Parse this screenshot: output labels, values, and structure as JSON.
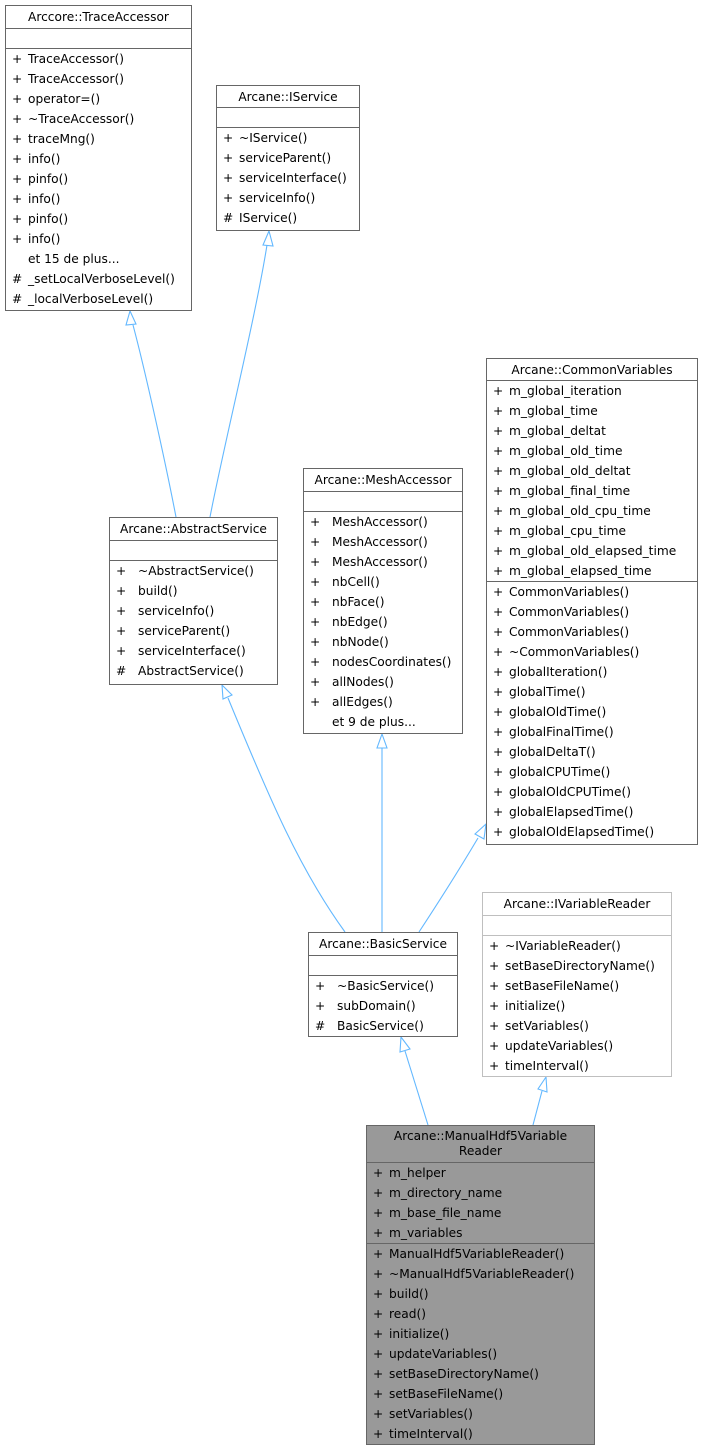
{
  "diagram": {
    "type": "class-inheritance",
    "edge_color": "#63b8ff",
    "focus_fill": "#999999",
    "classes": {
      "trace_accessor": {
        "name": "Arccore::TraceAccessor",
        "attributes": [],
        "methods": [
          {
            "vis": "+",
            "name": "TraceAccessor()"
          },
          {
            "vis": "+",
            "name": "TraceAccessor()"
          },
          {
            "vis": "+",
            "name": "operator=()"
          },
          {
            "vis": "+",
            "name": "~TraceAccessor()"
          },
          {
            "vis": "+",
            "name": "traceMng()"
          },
          {
            "vis": "+",
            "name": "info()"
          },
          {
            "vis": "+",
            "name": "pinfo()"
          },
          {
            "vis": "+",
            "name": "info()"
          },
          {
            "vis": "+",
            "name": "pinfo()"
          },
          {
            "vis": "+",
            "name": "info()"
          },
          {
            "vis": "",
            "name": "et 15 de plus..."
          },
          {
            "vis": "#",
            "name": "_setLocalVerboseLevel()"
          },
          {
            "vis": "#",
            "name": "_localVerboseLevel()"
          }
        ]
      },
      "iservice": {
        "name": "Arcane::IService",
        "attributes": [],
        "methods": [
          {
            "vis": "+",
            "name": "~IService()"
          },
          {
            "vis": "+",
            "name": "serviceParent()"
          },
          {
            "vis": "+",
            "name": "serviceInterface()"
          },
          {
            "vis": "+",
            "name": "serviceInfo()"
          },
          {
            "vis": "#",
            "name": "IService()"
          }
        ]
      },
      "common_variables": {
        "name": "Arcane::CommonVariables",
        "attributes": [
          {
            "vis": "+",
            "name": "m_global_iteration"
          },
          {
            "vis": "+",
            "name": "m_global_time"
          },
          {
            "vis": "+",
            "name": "m_global_deltat"
          },
          {
            "vis": "+",
            "name": "m_global_old_time"
          },
          {
            "vis": "+",
            "name": "m_global_old_deltat"
          },
          {
            "vis": "+",
            "name": "m_global_final_time"
          },
          {
            "vis": "+",
            "name": "m_global_old_cpu_time"
          },
          {
            "vis": "+",
            "name": "m_global_cpu_time"
          },
          {
            "vis": "+",
            "name": "m_global_old_elapsed_time"
          },
          {
            "vis": "+",
            "name": "m_global_elapsed_time"
          }
        ],
        "methods": [
          {
            "vis": "+",
            "name": "CommonVariables()"
          },
          {
            "vis": "+",
            "name": "CommonVariables()"
          },
          {
            "vis": "+",
            "name": "CommonVariables()"
          },
          {
            "vis": "+",
            "name": "~CommonVariables()"
          },
          {
            "vis": "+",
            "name": "globalIteration()"
          },
          {
            "vis": "+",
            "name": "globalTime()"
          },
          {
            "vis": "+",
            "name": "globalOldTime()"
          },
          {
            "vis": "+",
            "name": "globalFinalTime()"
          },
          {
            "vis": "+",
            "name": "globalDeltaT()"
          },
          {
            "vis": "+",
            "name": "globalCPUTime()"
          },
          {
            "vis": "+",
            "name": "globalOldCPUTime()"
          },
          {
            "vis": "+",
            "name": "globalElapsedTime()"
          },
          {
            "vis": "+",
            "name": "globalOldElapsedTime()"
          }
        ]
      },
      "mesh_accessor": {
        "name": "Arcane::MeshAccessor",
        "attributes": [],
        "methods": [
          {
            "vis": "+",
            "name": "MeshAccessor()"
          },
          {
            "vis": "+",
            "name": "MeshAccessor()"
          },
          {
            "vis": "+",
            "name": "MeshAccessor()"
          },
          {
            "vis": "+",
            "name": "nbCell()"
          },
          {
            "vis": "+",
            "name": "nbFace()"
          },
          {
            "vis": "+",
            "name": "nbEdge()"
          },
          {
            "vis": "+",
            "name": "nbNode()"
          },
          {
            "vis": "+",
            "name": "nodesCoordinates()"
          },
          {
            "vis": "+",
            "name": "allNodes()"
          },
          {
            "vis": "+",
            "name": "allEdges()"
          },
          {
            "vis": "",
            "name": "et 9 de plus..."
          }
        ]
      },
      "abstract_service": {
        "name": "Arcane::AbstractService",
        "attributes": [],
        "methods": [
          {
            "vis": "+",
            "name": "~AbstractService()"
          },
          {
            "vis": "+",
            "name": "build()"
          },
          {
            "vis": "+",
            "name": "serviceInfo()"
          },
          {
            "vis": "+",
            "name": "serviceParent()"
          },
          {
            "vis": "+",
            "name": "serviceInterface()"
          },
          {
            "vis": "#",
            "name": "AbstractService()"
          }
        ]
      },
      "basic_service": {
        "name": "Arcane::BasicService",
        "attributes": [],
        "methods": [
          {
            "vis": "+",
            "name": "~BasicService()"
          },
          {
            "vis": "+",
            "name": "subDomain()"
          },
          {
            "vis": "#",
            "name": "BasicService()"
          }
        ]
      },
      "ivariable_reader": {
        "name": "Arcane::IVariableReader",
        "attributes": [],
        "methods": [
          {
            "vis": "+",
            "name": "~IVariableReader()"
          },
          {
            "vis": "+",
            "name": "setBaseDirectoryName()"
          },
          {
            "vis": "+",
            "name": "setBaseFileName()"
          },
          {
            "vis": "+",
            "name": "initialize()"
          },
          {
            "vis": "+",
            "name": "setVariables()"
          },
          {
            "vis": "+",
            "name": "updateVariables()"
          },
          {
            "vis": "+",
            "name": "timeInterval()"
          }
        ]
      },
      "manual_hdf5_variable_reader": {
        "name_line1": "Arcane::ManualHdf5Variable",
        "name_line2": "Reader",
        "attributes": [
          {
            "vis": "+",
            "name": "m_helper"
          },
          {
            "vis": "+",
            "name": "m_directory_name"
          },
          {
            "vis": "+",
            "name": "m_base_file_name"
          },
          {
            "vis": "+",
            "name": "m_variables"
          }
        ],
        "methods": [
          {
            "vis": "+",
            "name": "ManualHdf5VariableReader()"
          },
          {
            "vis": "+",
            "name": "~ManualHdf5VariableReader()"
          },
          {
            "vis": "+",
            "name": "build()"
          },
          {
            "vis": "+",
            "name": "read()"
          },
          {
            "vis": "+",
            "name": "initialize()"
          },
          {
            "vis": "+",
            "name": "updateVariables()"
          },
          {
            "vis": "+",
            "name": "setBaseDirectoryName()"
          },
          {
            "vis": "+",
            "name": "setBaseFileName()"
          },
          {
            "vis": "+",
            "name": "setVariables()"
          },
          {
            "vis": "+",
            "name": "timeInterval()"
          }
        ]
      }
    },
    "inheritance": [
      {
        "child": "abstract_service",
        "parent": "trace_accessor"
      },
      {
        "child": "abstract_service",
        "parent": "iservice"
      },
      {
        "child": "basic_service",
        "parent": "abstract_service"
      },
      {
        "child": "basic_service",
        "parent": "mesh_accessor"
      },
      {
        "child": "basic_service",
        "parent": "common_variables"
      },
      {
        "child": "manual_hdf5_variable_reader",
        "parent": "basic_service"
      },
      {
        "child": "manual_hdf5_variable_reader",
        "parent": "ivariable_reader"
      }
    ]
  }
}
